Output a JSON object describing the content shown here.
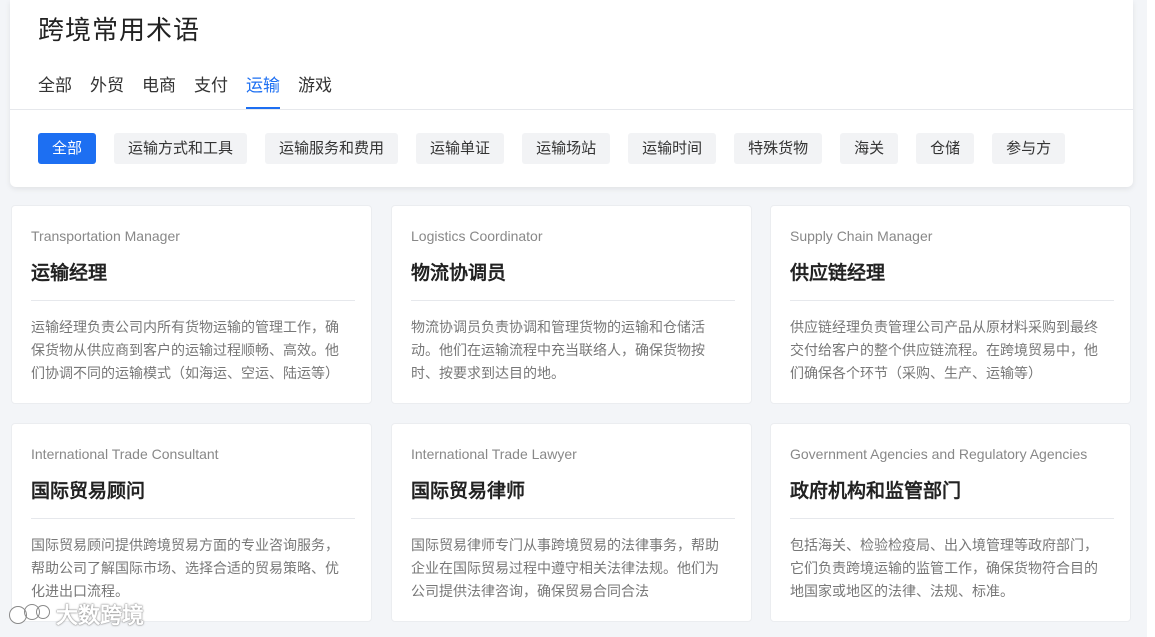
{
  "header": {
    "title": "跨境常用术语"
  },
  "tabs": [
    {
      "label": "全部",
      "active": false
    },
    {
      "label": "外贸",
      "active": false
    },
    {
      "label": "电商",
      "active": false
    },
    {
      "label": "支付",
      "active": false
    },
    {
      "label": "运输",
      "active": true
    },
    {
      "label": "游戏",
      "active": false
    }
  ],
  "chips": [
    {
      "label": "全部",
      "active": true
    },
    {
      "label": "运输方式和工具",
      "active": false
    },
    {
      "label": "运输服务和费用",
      "active": false
    },
    {
      "label": "运输单证",
      "active": false
    },
    {
      "label": "运输场站",
      "active": false
    },
    {
      "label": "运输时间",
      "active": false
    },
    {
      "label": "特殊货物",
      "active": false
    },
    {
      "label": "海关",
      "active": false
    },
    {
      "label": "仓储",
      "active": false
    },
    {
      "label": "参与方",
      "active": false
    }
  ],
  "cards": [
    {
      "en": "Transportation Manager",
      "zh": "运输经理",
      "desc": "运输经理负责公司内所有货物运输的管理工作，确保货物从供应商到客户的运输过程顺畅、高效。他们协调不同的运输模式（如海运、空运、陆运等）"
    },
    {
      "en": "Logistics Coordinator",
      "zh": "物流协调员",
      "desc": "物流协调员负责协调和管理货物的运输和仓储活动。他们在运输流程中充当联络人，确保货物按时、按要求到达目的地。"
    },
    {
      "en": "Supply Chain Manager",
      "zh": "供应链经理",
      "desc": "供应链经理负责管理公司产品从原材料采购到最终交付给客户的整个供应链流程。在跨境贸易中，他们确保各个环节（采购、生产、运输等）"
    },
    {
      "en": "International Trade Consultant",
      "zh": "国际贸易顾问",
      "desc": "国际贸易顾问提供跨境贸易方面的专业咨询服务，帮助公司了解国际市场、选择合适的贸易策略、优化进出口流程。"
    },
    {
      "en": "International Trade Lawyer",
      "zh": "国际贸易律师",
      "desc": "国际贸易律师专门从事跨境贸易的法律事务，帮助企业在国际贸易过程中遵守相关法律法规。他们为公司提供法律咨询，确保贸易合同合法"
    },
    {
      "en": "Government Agencies and Regulatory Agencies",
      "zh": "政府机构和监管部门",
      "desc": "包括海关、检验检疫局、出入境管理等政府部门，它们负责跨境运输的监管工作，确保货物符合目的地国家或地区的法律、法规、标准。"
    }
  ],
  "watermark": {
    "text": "大数跨境"
  },
  "colors": {
    "accent": "#1d6ff2",
    "background": "#f3f5f8"
  }
}
